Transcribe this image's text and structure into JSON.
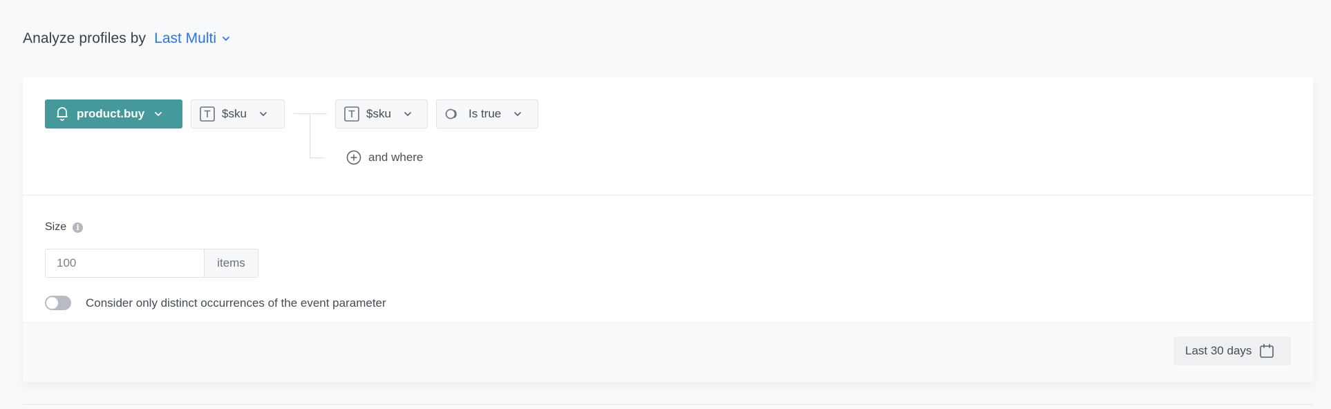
{
  "header": {
    "title": "Analyze profiles by",
    "select_value": "Last Multi"
  },
  "filter": {
    "event": {
      "icon": "bell-icon",
      "label": "product.buy"
    },
    "parameter": {
      "icon": "text-type-icon",
      "label": "$sku"
    },
    "condition": {
      "parameter": {
        "icon": "text-type-icon",
        "label": "$sku"
      },
      "operator": {
        "icon": "toggle-operator-icon",
        "label": "Is true"
      }
    },
    "add_condition_label": "and where"
  },
  "size": {
    "label": "Size",
    "input_placeholder": "100",
    "input_value": "",
    "suffix": "items"
  },
  "distinct_toggle": {
    "label": "Consider only distinct occurrences of the event parameter",
    "checked": false
  },
  "footer": {
    "date_range_label": "Last 30 days"
  },
  "colors": {
    "accent": "#2b73e6",
    "event_button": "#46999a"
  }
}
